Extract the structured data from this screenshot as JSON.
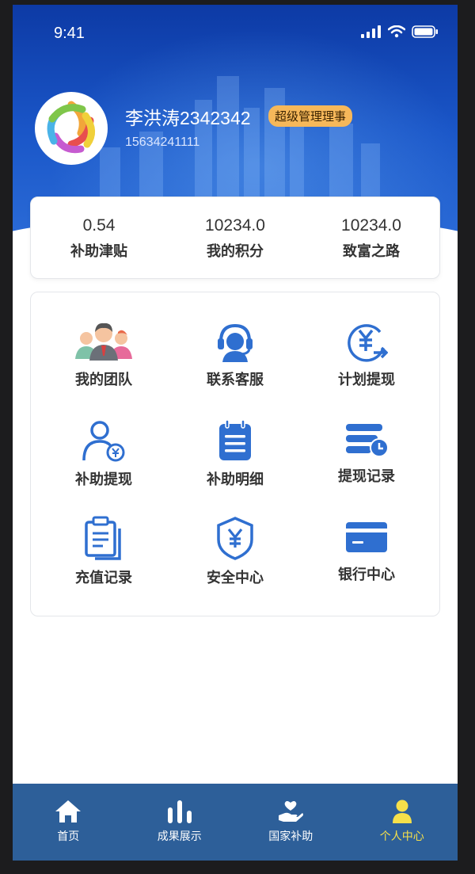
{
  "status_bar": {
    "time": "9:41"
  },
  "profile": {
    "name": "李洪涛2342342",
    "badge": "超级管理理事",
    "phone": "15634241111",
    "avatar_icon": "colorful-knot-logo"
  },
  "stats": [
    {
      "value": "0.54",
      "label": "补助津贴"
    },
    {
      "value": "10234.0",
      "label": "我的积分"
    },
    {
      "value": "10234.0",
      "label": "致富之路"
    }
  ],
  "menu": [
    {
      "label": "我的团队",
      "icon": "team-icon"
    },
    {
      "label": "联系客服",
      "icon": "customer-service-icon"
    },
    {
      "label": "计划提现",
      "icon": "yuan-withdraw-icon"
    },
    {
      "label": "补助提现",
      "icon": "user-yuan-icon"
    },
    {
      "label": "补助明细",
      "icon": "notepad-icon"
    },
    {
      "label": "提现记录",
      "icon": "records-clock-icon"
    },
    {
      "label": "充值记录",
      "icon": "clipboard-icon"
    },
    {
      "label": "安全中心",
      "icon": "shield-yuan-icon"
    },
    {
      "label": "银行中心",
      "icon": "bank-card-icon"
    }
  ],
  "tabbar": [
    {
      "label": "首页",
      "icon": "home-icon"
    },
    {
      "label": "成果展示",
      "icon": "bar-chart-icon"
    },
    {
      "label": "国家补助",
      "icon": "hand-heart-icon"
    },
    {
      "label": "个人中心",
      "icon": "person-icon",
      "active": true
    }
  ],
  "colors": {
    "primary": "#1a56c8",
    "icon_blue": "#2f6fd0",
    "tab_bg": "#2d5f99",
    "tab_active": "#f6e04a",
    "badge": "#f6b85a"
  }
}
